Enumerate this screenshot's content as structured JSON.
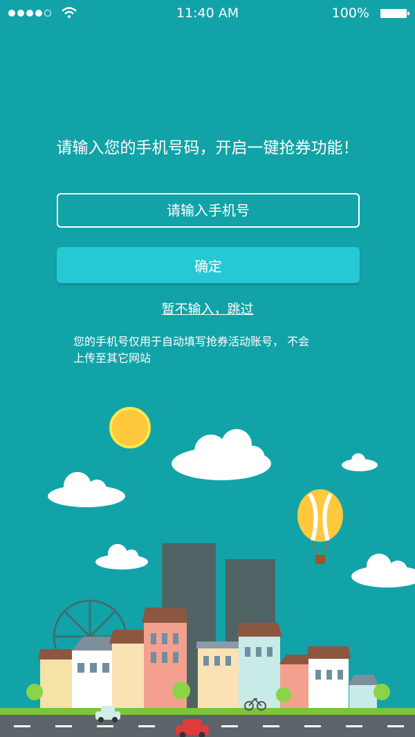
{
  "status_bar": {
    "time": "11:40 AM",
    "battery": "100%"
  },
  "headline": "请输入您的手机号码，开启一键抢券功能！",
  "phone_input": {
    "placeholder": "请输入手机号",
    "value": ""
  },
  "confirm_label": "确定",
  "skip_label": "暂不输入，跳过",
  "notice_line1": "您的手机号仅用于自动填写抢券活动账号， 不会",
  "notice_line2": "上传至其它网站",
  "colors": {
    "background": "#12a3a8",
    "button": "#25c8d3",
    "sun": "#ffc83d"
  },
  "icons": [
    "signal-dots-icon",
    "wifi-icon",
    "battery-icon"
  ]
}
